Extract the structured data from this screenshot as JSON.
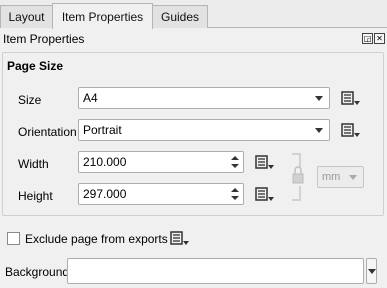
{
  "tabs": [
    {
      "label": "Layout",
      "active": false
    },
    {
      "label": "Item Properties",
      "active": true
    },
    {
      "label": "Guides",
      "active": false
    }
  ],
  "panel": {
    "title": "Item Properties",
    "float_icon": "float-icon",
    "close_icon": "close-icon"
  },
  "page_size": {
    "group_title": "Page Size",
    "size": {
      "label": "Size",
      "value": "A4"
    },
    "orientation": {
      "label": "Orientation",
      "value": "Portrait"
    },
    "width": {
      "label": "Width",
      "value": "210.000"
    },
    "height": {
      "label": "Height",
      "value": "297.000"
    },
    "units": {
      "value": "mm",
      "enabled": false
    },
    "lock_icon": "lock-icon"
  },
  "exclude": {
    "label": "Exclude page from exports",
    "checked": false
  },
  "background": {
    "label": "Background",
    "value": ""
  },
  "icons": {
    "data_defined": "data-defined-override-icon"
  },
  "colors": {
    "accent_dark": "#3a3a3a",
    "border": "#adadad"
  }
}
